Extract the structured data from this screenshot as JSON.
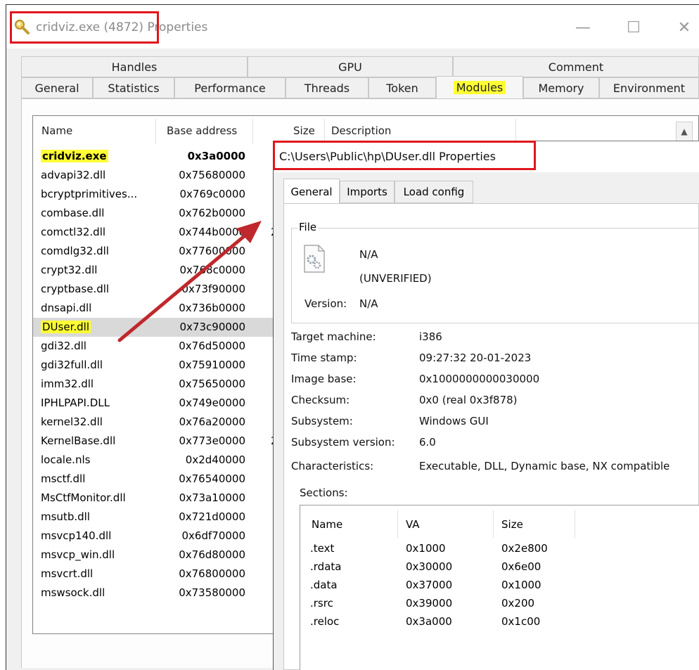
{
  "window": {
    "title": "cridviz.exe (4872) Properties",
    "minimize_label": "—",
    "maximize_label": "☐",
    "close_label": "✕"
  },
  "tabs_row1": [
    "Handles",
    "GPU",
    "Comment"
  ],
  "tabs_row2": [
    "General",
    "Statistics",
    "Performance",
    "Threads",
    "Token",
    "Modules",
    "Memory",
    "Environment"
  ],
  "active_tab": "Modules",
  "modules": {
    "columns": [
      "Name",
      "Base address",
      "Size",
      "Description"
    ],
    "rows": [
      {
        "name": "cridviz.exe",
        "base": "0x3a0000"
      },
      {
        "name": "advapi32.dll",
        "base": "0x75680000"
      },
      {
        "name": "bcryptprimitives...",
        "base": "0x769c0000"
      },
      {
        "name": "combase.dll",
        "base": "0x762b0000"
      },
      {
        "name": "comctl32.dll",
        "base": "0x744b0000"
      },
      {
        "name": "comdlg32.dll",
        "base": "0x77600000"
      },
      {
        "name": "crypt32.dll",
        "base": "0x768c0000"
      },
      {
        "name": "cryptbase.dll",
        "base": "0x73f90000"
      },
      {
        "name": "dnsapi.dll",
        "base": "0x736b0000"
      },
      {
        "name": "DUser.dll",
        "base": "0x73c90000"
      },
      {
        "name": "gdi32.dll",
        "base": "0x76d50000"
      },
      {
        "name": "gdi32full.dll",
        "base": "0x75910000"
      },
      {
        "name": "imm32.dll",
        "base": "0x75650000"
      },
      {
        "name": "IPHLPAPI.DLL",
        "base": "0x749e0000"
      },
      {
        "name": "kernel32.dll",
        "base": "0x76a20000"
      },
      {
        "name": "KernelBase.dll",
        "base": "0x773e0000"
      },
      {
        "name": "locale.nls",
        "base": "0x2d40000"
      },
      {
        "name": "msctf.dll",
        "base": "0x76540000"
      },
      {
        "name": "MsCtfMonitor.dll",
        "base": "0x73a10000"
      },
      {
        "name": "msutb.dll",
        "base": "0x721d0000"
      },
      {
        "name": "msvcp140.dll",
        "base": "0x6df70000"
      },
      {
        "name": "msvcp_win.dll",
        "base": "0x76d80000"
      },
      {
        "name": "msvcrt.dll",
        "base": "0x76800000"
      },
      {
        "name": "mswsock.dll",
        "base": "0x73580000"
      }
    ],
    "size_fragments": [
      "2",
      "2"
    ]
  },
  "dll_window": {
    "title": "C:\\Users\\Public\\hp\\DUser.dll Properties",
    "tabs": [
      "General",
      "Imports",
      "Load config"
    ],
    "file_group_label": "File",
    "file_name": "N/A",
    "file_verification": "(UNVERIFIED)",
    "version_label": "Version:",
    "version_value": "N/A",
    "fields": [
      {
        "label": "Target machine:",
        "value": "i386"
      },
      {
        "label": "Time stamp:",
        "value": "09:27:32 20-01-2023"
      },
      {
        "label": "Image base:",
        "value": "0x1000000000030000"
      },
      {
        "label": "Checksum:",
        "value": "0x0 (real 0x3f878)"
      },
      {
        "label": "Subsystem:",
        "value": "Windows GUI"
      },
      {
        "label": "Subsystem version:",
        "value": "6.0"
      },
      {
        "label": "Characteristics:",
        "value": "Executable, DLL, Dynamic base, NX compatible"
      }
    ],
    "sections_label": "Sections:",
    "sections_columns": [
      "Name",
      "VA",
      "Size"
    ],
    "sections": [
      {
        "name": ".text",
        "va": "0x1000",
        "size": "0x2e800"
      },
      {
        "name": ".rdata",
        "va": "0x30000",
        "size": "0x6e00"
      },
      {
        "name": ".data",
        "va": "0x37000",
        "size": "0x1000"
      },
      {
        "name": ".rsrc",
        "va": "0x39000",
        "size": "0x200"
      },
      {
        "name": ".reloc",
        "va": "0x3a000",
        "size": "0x1c00"
      }
    ]
  },
  "colors": {
    "highlight": "#ffff33",
    "annotation_red": "#e0161c",
    "arrow": "#c0282d",
    "selected_row": "#d9d9d9"
  }
}
